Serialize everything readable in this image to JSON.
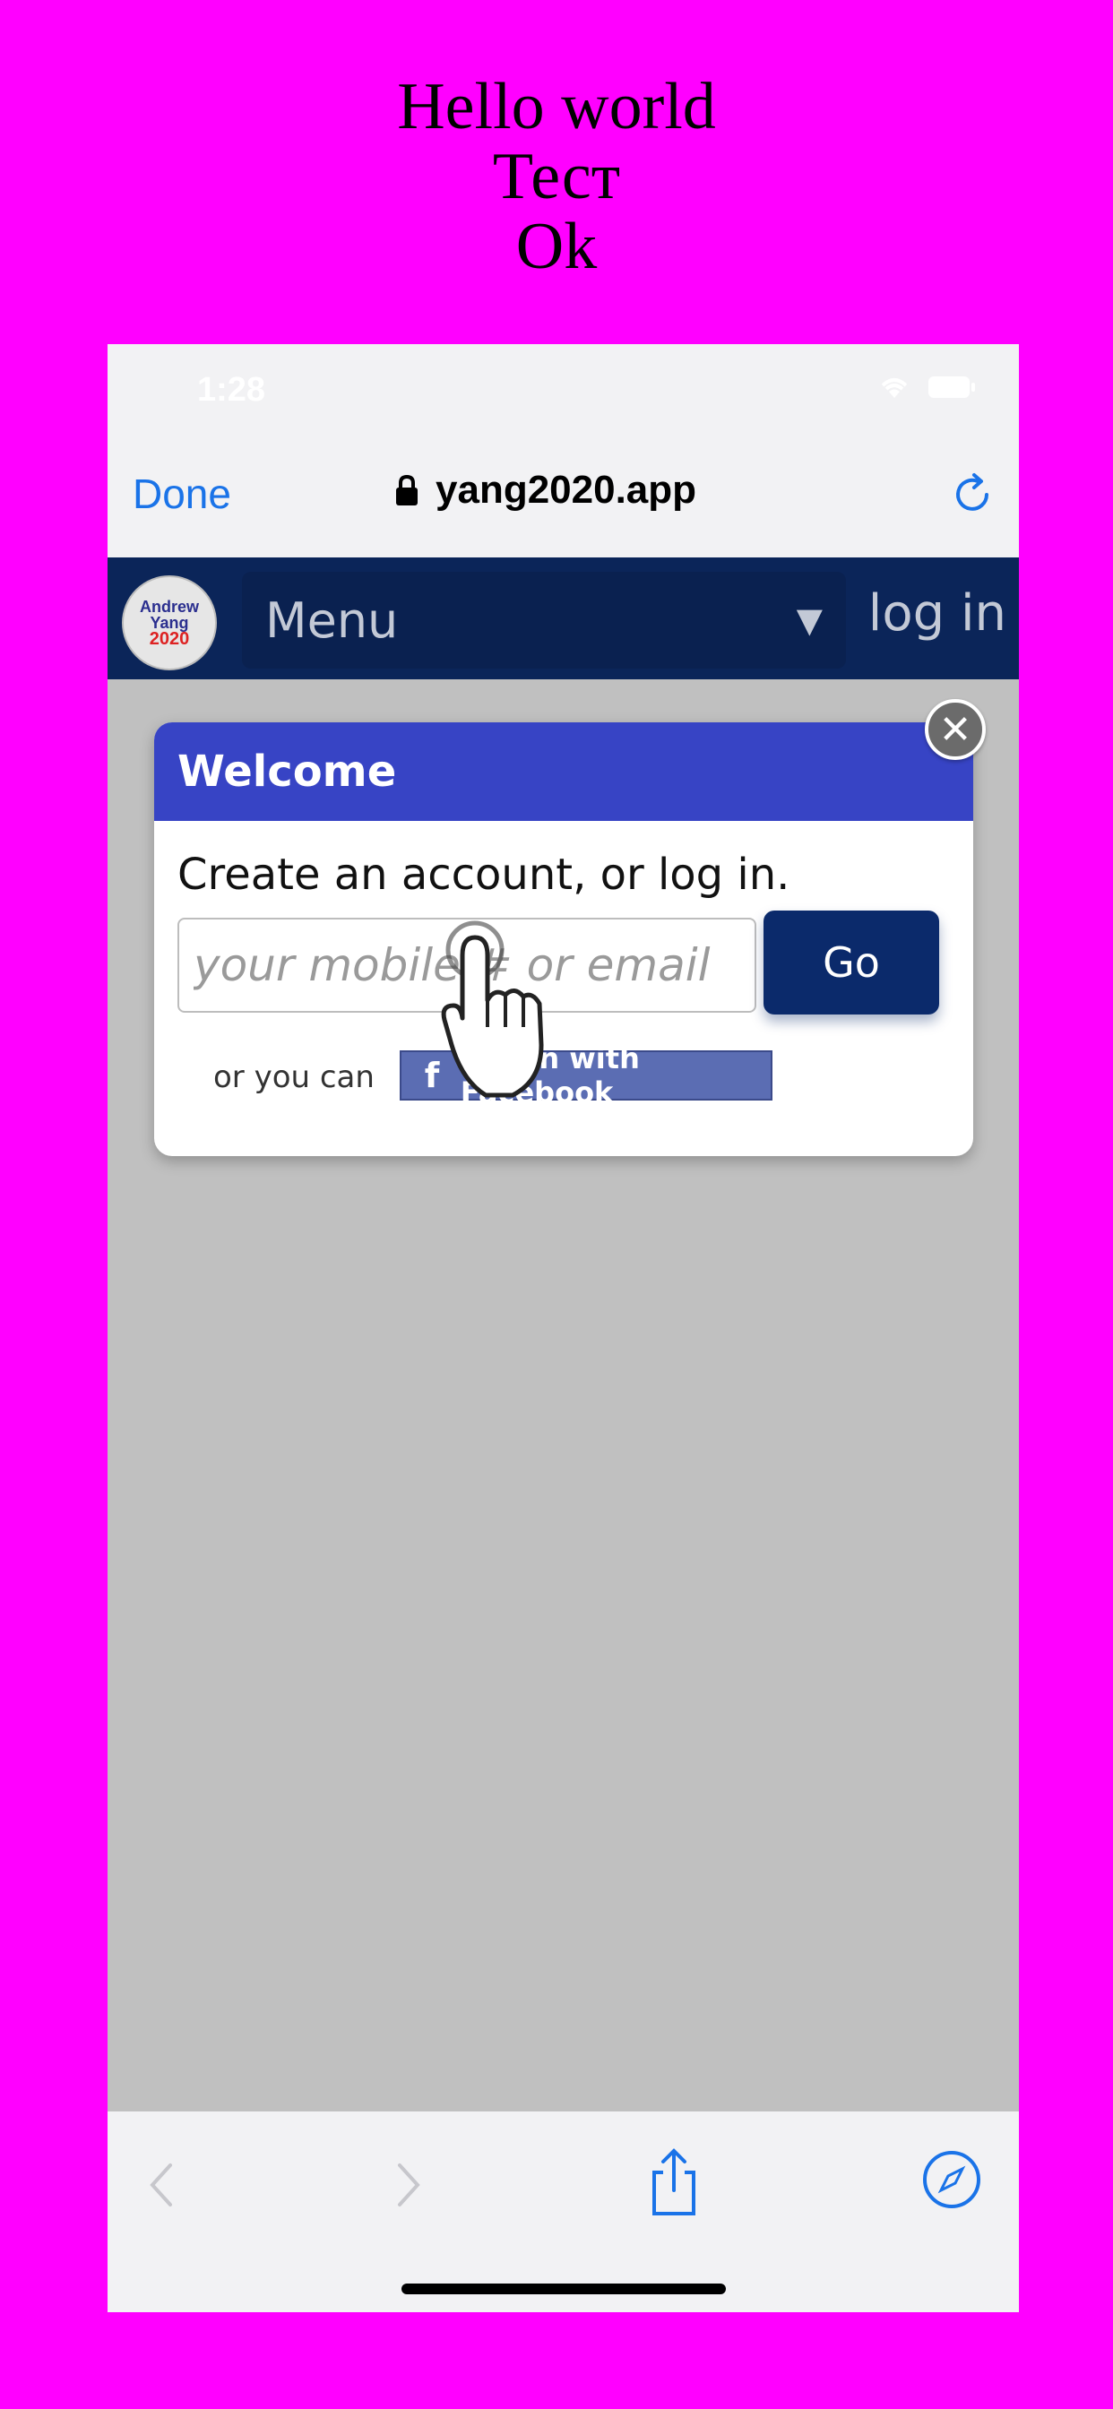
{
  "caption": {
    "line1": "Hello world",
    "line2": "Тест",
    "line3": "Ok"
  },
  "status_bar": {
    "time": "1:28"
  },
  "browser": {
    "done_label": "Done",
    "url": "yang2020.app"
  },
  "site_nav": {
    "logo": {
      "line1": "Andrew",
      "line2": "Yang",
      "line3": "2020"
    },
    "menu_label": "Menu",
    "menu_arrow": "▼",
    "login_label": "log in"
  },
  "modal": {
    "title": "Welcome",
    "text": "Create an account, or log in.",
    "input_placeholder": "your mobile # or email",
    "go_label": "Go",
    "or_text": "or you can",
    "facebook_label": "Log in with Facebook",
    "close_symbol": "✕"
  },
  "colors": {
    "page_background": "#ff00ff",
    "nav_background": "#0b2559",
    "modal_header": "#3744c5",
    "go_button": "#0b2a6b",
    "accent": "#1a73e8"
  }
}
